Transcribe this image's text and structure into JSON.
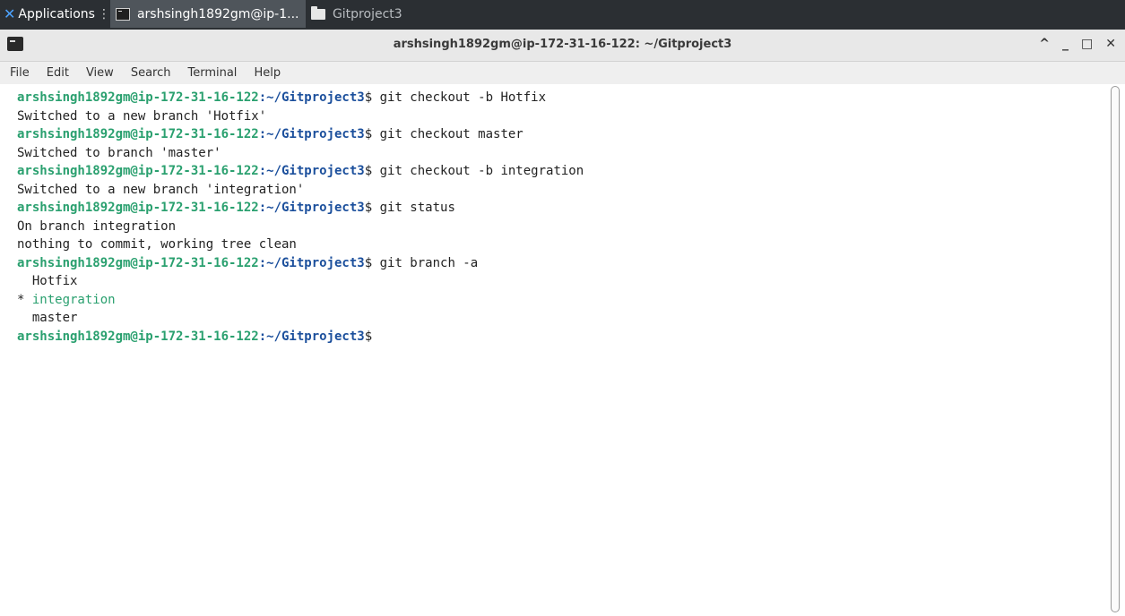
{
  "taskbar": {
    "applications_label": "Applications",
    "tabs": [
      {
        "label": "arshsingh1892gm@ip-1...",
        "icon": "terminal-icon",
        "active": true
      },
      {
        "label": "Gitproject3",
        "icon": "folder-icon",
        "active": false
      }
    ]
  },
  "window": {
    "title": "arshsingh1892gm@ip-172-31-16-122: ~/Gitproject3",
    "buttons": [
      "^",
      "_",
      "□",
      "✕"
    ]
  },
  "menu": [
    "File",
    "Edit",
    "View",
    "Search",
    "Terminal",
    "Help"
  ],
  "terminal": {
    "prompt_user": "arshsingh1892gm@ip-172-31-16-122",
    "prompt_path": ":~/Gitproject3",
    "lines": [
      {
        "type": "prompt",
        "cmd": "$ git checkout -b Hotfix"
      },
      {
        "type": "out",
        "text": "Switched to a new branch 'Hotfix'"
      },
      {
        "type": "prompt",
        "cmd": "$ git checkout master"
      },
      {
        "type": "out",
        "text": "Switched to branch 'master'"
      },
      {
        "type": "prompt",
        "cmd": "$ git checkout -b integration"
      },
      {
        "type": "out",
        "text": "Switched to a new branch 'integration'"
      },
      {
        "type": "prompt",
        "cmd": "$ git status"
      },
      {
        "type": "out",
        "text": "On branch integration"
      },
      {
        "type": "out",
        "text": "nothing to commit, working tree clean"
      },
      {
        "type": "prompt",
        "cmd": "$ git branch -a"
      },
      {
        "type": "out",
        "text": "  Hotfix"
      },
      {
        "type": "current",
        "marker": "* ",
        "text": "integration"
      },
      {
        "type": "out",
        "text": "  master"
      },
      {
        "type": "prompt",
        "cmd": "$"
      }
    ]
  },
  "colors": {
    "prompt_user": "#2aa06f",
    "prompt_path": "#1b4f9c",
    "taskbar_bg": "#2b2f33"
  }
}
